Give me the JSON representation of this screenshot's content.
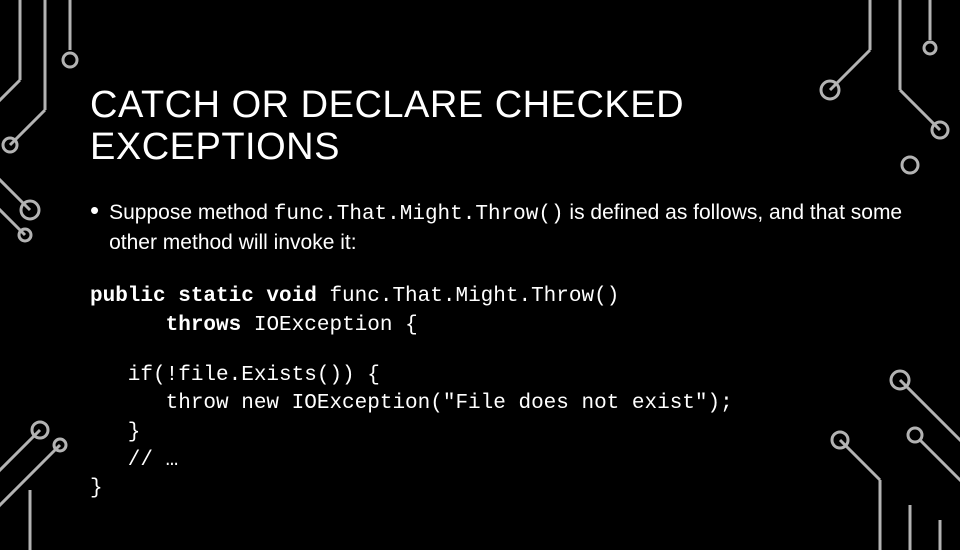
{
  "title": "CATCH OR DECLARE CHECKED EXCEPTIONS",
  "bullet": {
    "prefix": "Suppose method ",
    "method": "func.That.Might.Throw()",
    "suffix": "  is defined as follows, and that some other method will invoke it:"
  },
  "code": {
    "sig_kw": "public static void",
    "sig_name": " func.That.Might.Throw()",
    "throws_indent": "      ",
    "throws_kw": "throws",
    "throws_type": " IOException {",
    "body_l1": "   if(!file.Exists()) {",
    "body_l2": "      throw new IOException(\"File does not exist\");",
    "body_l3": "   }",
    "body_l4": "   // …",
    "body_l5": "}"
  }
}
